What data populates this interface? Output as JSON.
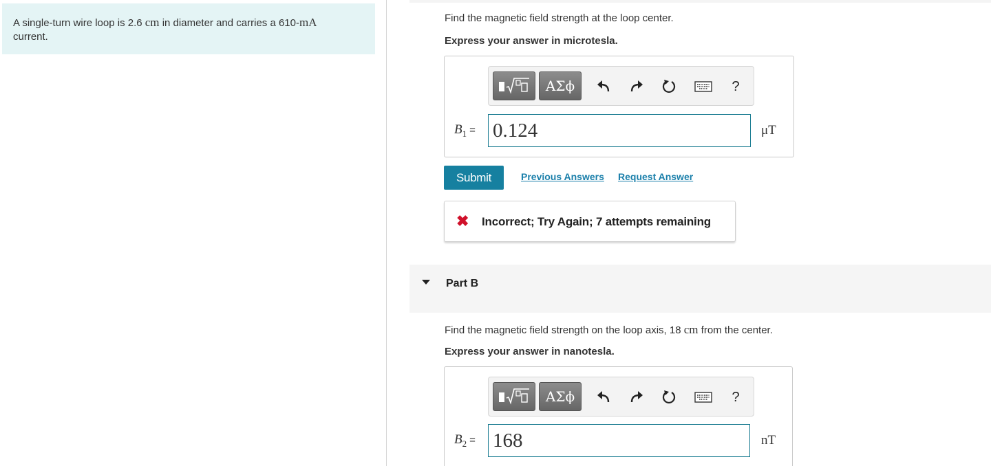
{
  "problem": {
    "text_1": "A single-turn wire loop is 2.6 ",
    "unit_cm": "cm",
    "text_2": " in diameter and carries a 610-",
    "unit_ma": "mA",
    "text_3": "current."
  },
  "part_a": {
    "question": "Find the magnetic field strength at the loop center.",
    "instruction": "Express your answer in microtesla.",
    "toolbar": {
      "greek": "ΑΣϕ",
      "undo_icon": "undo-icon",
      "redo_icon": "redo-icon",
      "reset_icon": "reset-icon",
      "keyboard_icon": "keyboard-icon",
      "help": "?"
    },
    "variable": "B",
    "subscript": "1",
    "equals": "=",
    "answer_value": "0.124",
    "unit": "μT",
    "submit_label": "Submit",
    "previous_answers_label": "Previous Answers",
    "request_answer_label": "Request Answer",
    "feedback": "Incorrect; Try Again; 7 attempts remaining"
  },
  "part_b": {
    "title": "Part B",
    "question_1": "Find the magnetic field strength on the loop axis, 18 ",
    "question_unit": "cm",
    "question_2": " from the center.",
    "instruction": "Express your answer in nanotesla.",
    "toolbar": {
      "greek": "ΑΣϕ",
      "help": "?"
    },
    "variable": "B",
    "subscript": "2",
    "equals": "=",
    "answer_value": "168",
    "unit": "nT"
  },
  "colors": {
    "accent": "#1680a0",
    "link": "#1a7faa",
    "error": "#d0112b",
    "problem_bg": "#e4f4f5"
  }
}
